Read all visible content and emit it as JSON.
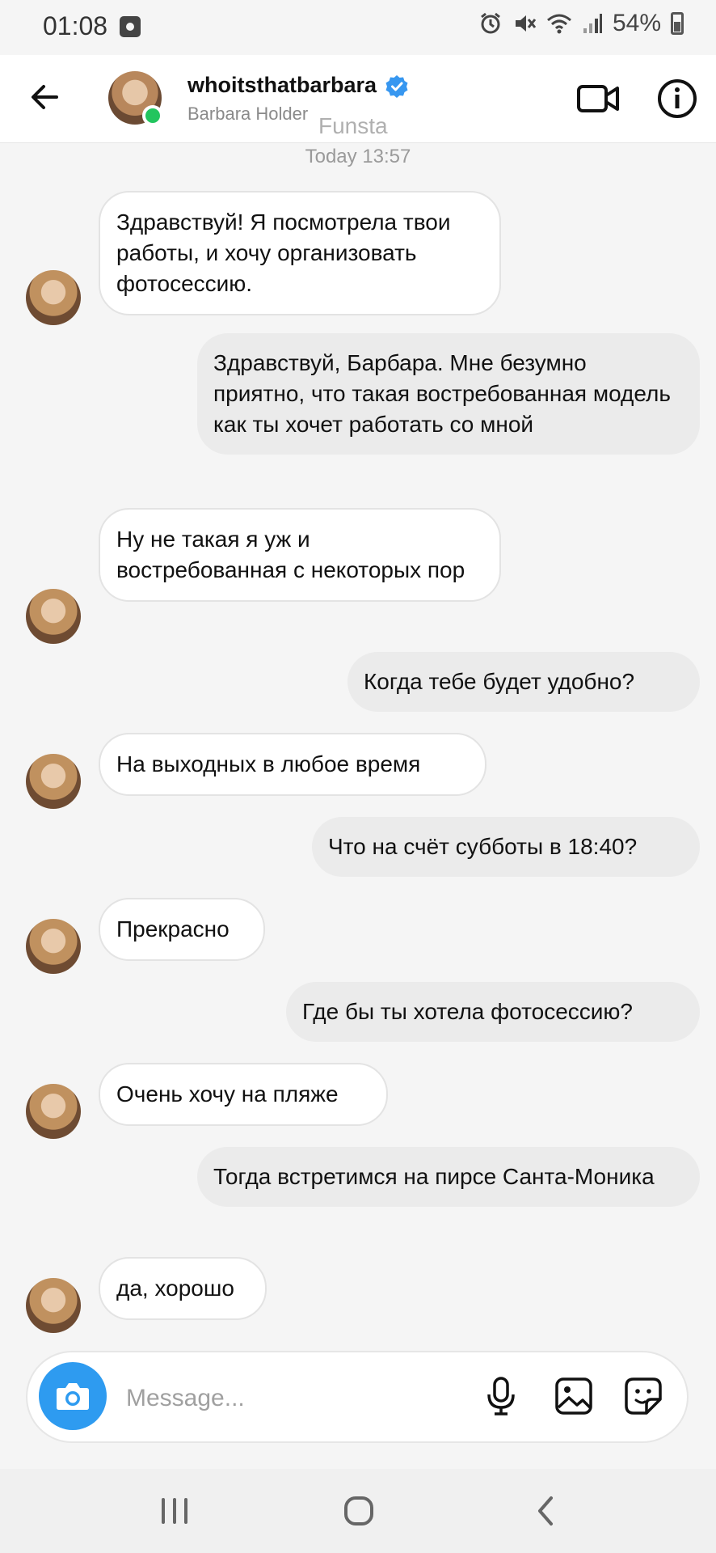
{
  "status_bar": {
    "time": "01:08",
    "battery": "54%"
  },
  "header": {
    "username": "whoitsthatbarbara",
    "full_name": "Barbara Holder",
    "verified": true,
    "online": true,
    "icons": {
      "back": "back-arrow-icon",
      "video": "video-call-icon",
      "info": "info-icon"
    }
  },
  "watermark": "Funsta",
  "date_stamp": "Today 13:57",
  "messages": [
    {
      "from": "them",
      "text": "Здравствуй! Я посмотрела твои работы, и хочу организовать фотосессию."
    },
    {
      "from": "me",
      "text": "Здравствуй, Барбара. Мне безумно приятно, что такая востребованная модель как ты хочет работать со мной"
    },
    {
      "from": "them",
      "text": "Ну не такая я уж и востребованная с некоторых пор"
    },
    {
      "from": "me",
      "text": "Когда тебе будет удобно?"
    },
    {
      "from": "them",
      "text": "На выходных в любое время"
    },
    {
      "from": "me",
      "text": "Что на счёт субботы в 18:40?"
    },
    {
      "from": "them",
      "text": "Прекрасно"
    },
    {
      "from": "me",
      "text": "Где бы ты хотела фотосессию?"
    },
    {
      "from": "them",
      "text": "Очень хочу на пляже"
    },
    {
      "from": "me",
      "text": "Тогда встретимся на пирсе Санта-Моника"
    },
    {
      "from": "them",
      "text": "да, хорошо"
    }
  ],
  "composer": {
    "placeholder": "Message...",
    "icons": [
      "camera-icon",
      "microphone-icon",
      "gallery-icon",
      "sticker-icon"
    ]
  },
  "colors": {
    "accent": "#2e9bf0",
    "online": "#22c55e",
    "verified": "#3797f0",
    "outgoing_bubble": "#ebebeb"
  }
}
